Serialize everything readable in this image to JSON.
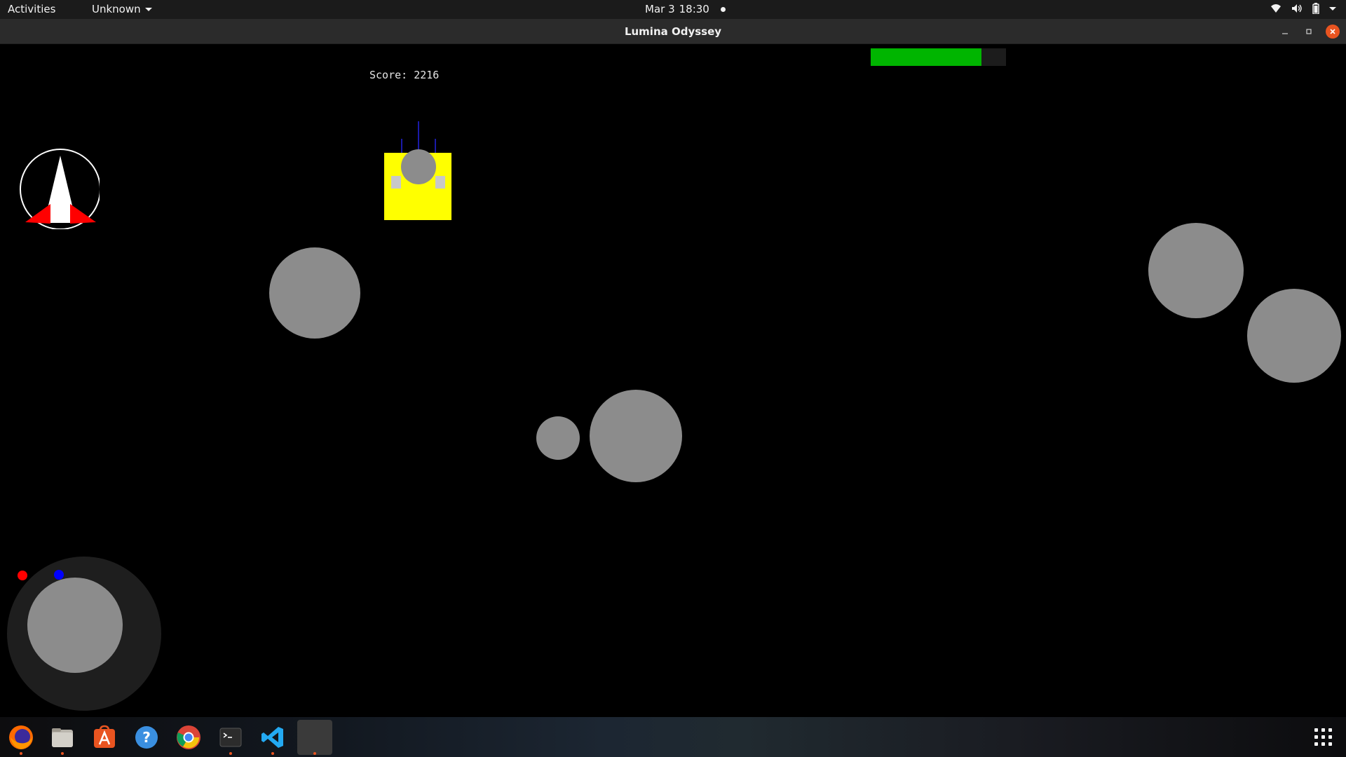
{
  "topbar": {
    "activities": "Activities",
    "app_menu": "Unknown",
    "date": "Mar 3",
    "time": "18:30",
    "icons": [
      "wifi-icon",
      "volume-icon",
      "battery-icon",
      "system-menu-chevron-icon"
    ]
  },
  "window": {
    "title": "Lumina Odyssey",
    "controls": [
      "minimize-icon",
      "maximize-icon",
      "close-icon"
    ]
  },
  "game": {
    "score_label": "Score: 2216",
    "score": 2216,
    "health_fraction": 0.82,
    "colors": {
      "background": "#000000",
      "asteroid": "#8c8c8c",
      "health": "#00b500",
      "enemy_ship": "#ffff00",
      "player_ship": "#ffffff",
      "thruster": "#ff0000",
      "joystick_base": "#1e1e1e"
    }
  },
  "dock": {
    "items": [
      {
        "name": "firefox-icon",
        "running": true
      },
      {
        "name": "files-icon",
        "running": true
      },
      {
        "name": "software-center-icon",
        "running": false
      },
      {
        "name": "help-icon",
        "running": false
      },
      {
        "name": "chrome-icon",
        "running": false
      },
      {
        "name": "terminal-icon",
        "running": true
      },
      {
        "name": "vscode-icon",
        "running": true
      },
      {
        "name": "game-window-icon",
        "running": true,
        "active": true
      }
    ],
    "app_grid": "show-applications-icon"
  }
}
